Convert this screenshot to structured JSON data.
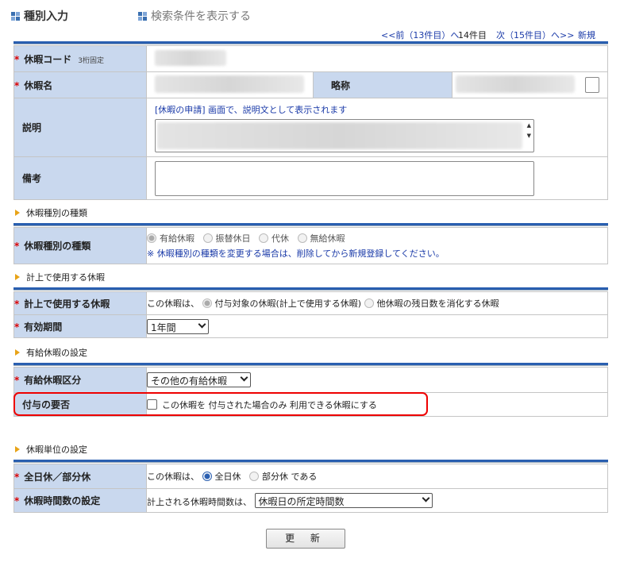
{
  "tabs": {
    "input": "種別入力",
    "search": "検索条件を表示する"
  },
  "nav": {
    "prev": "<<前（13件目）へ",
    "current": "14件目",
    "next": "次（15件目）へ>>",
    "new": "新規"
  },
  "basic": {
    "code_label": "休暇コード",
    "code_sub": "3桁固定",
    "name_label": "休暇名",
    "abbr_label": "略称",
    "desc_label": "説明",
    "desc_note": "[休暇の申請] 画面で、説明文として表示されます",
    "remarks_label": "備考"
  },
  "sec_kind": {
    "title": "休暇種別の種類",
    "label": "休暇種別の種類",
    "options": [
      "有給休暇",
      "振替休日",
      "代休",
      "無給休暇"
    ],
    "notice": "※ 休暇種別の種類を変更する場合は、削除してから新規登録してください。"
  },
  "sec_plan": {
    "title": "計上で使用する休暇",
    "label": "計上で使用する休暇",
    "prefix": "この休暇は、",
    "opt1": "付与対象の休暇(計上で使用する休暇)",
    "opt2": "他休暇の残日数を消化する休暇",
    "period_label": "有効期間",
    "period_value": "1年間"
  },
  "sec_paid": {
    "title": "有給休暇の設定",
    "class_label": "有給休暇区分",
    "class_value": "その他の有給休暇",
    "grant_label": "付与の要否",
    "grant_text": "この休暇を 付与された場合のみ 利用できる休暇にする"
  },
  "sec_unit": {
    "title": "休暇単位の設定",
    "unit_label": "全日休／部分休",
    "unit_prefix": "この休暇は、",
    "opt_full": "全日休",
    "opt_part": "部分休 である",
    "hours_label": "休暇時間数の設定",
    "hours_prefix": "計上される休暇時間数は、",
    "hours_value": "休暇日の所定時間数"
  },
  "update_button": "更 新",
  "colors": {
    "header_line": "#2a5fb0",
    "label_bg": "#c9d8ee",
    "required": "#dd0000",
    "highlight": "#ee0000"
  }
}
